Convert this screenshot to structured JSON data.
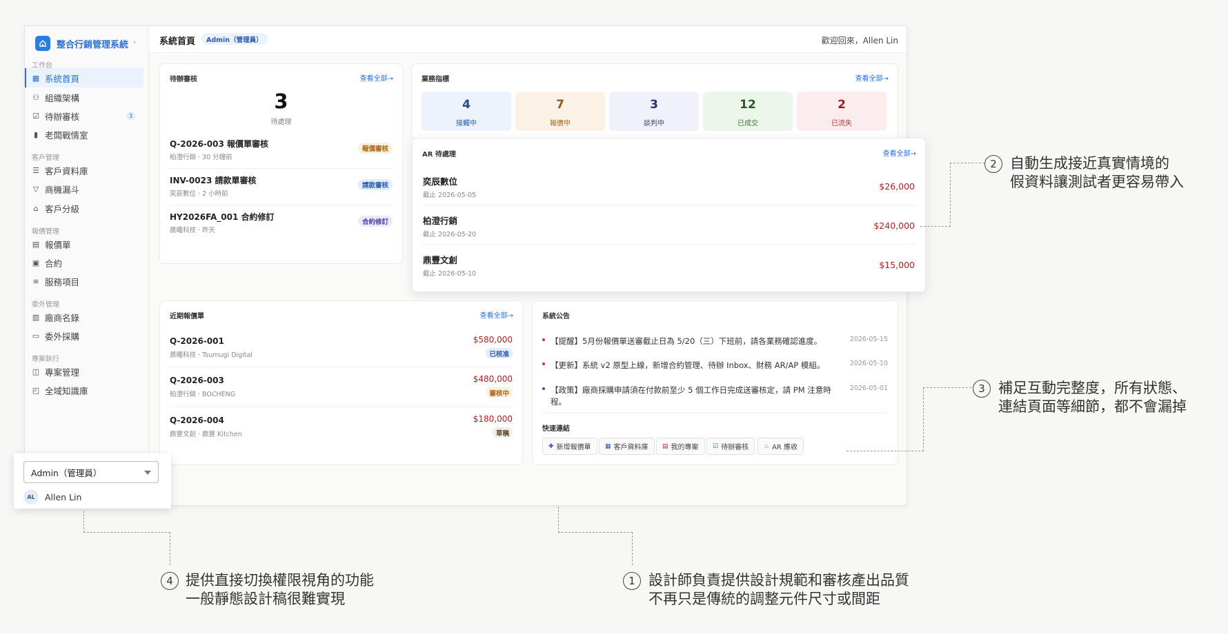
{
  "sidebar": {
    "brand": "整合行銷管理系統",
    "collapse_icon": "‹",
    "sections": [
      {
        "label": "工作台"
      },
      {
        "label": "客戶管理"
      },
      {
        "label": "報價管理"
      },
      {
        "label": "委外管理"
      },
      {
        "label": "專案執行"
      }
    ],
    "items": [
      {
        "label": "系統首頁",
        "icon": "grid-icon",
        "active": true
      },
      {
        "label": "組織架構",
        "icon": "org-chart-icon"
      },
      {
        "label": "待辦審核",
        "icon": "check-square-icon",
        "badge": "3"
      },
      {
        "label": "老闆戰情室",
        "icon": "bar-chart-icon"
      },
      {
        "label": "客戶資料庫",
        "icon": "database-icon"
      },
      {
        "label": "商機漏斗",
        "icon": "funnel-icon"
      },
      {
        "label": "客戶分級",
        "icon": "home-icon"
      },
      {
        "label": "報價單",
        "icon": "document-icon"
      },
      {
        "label": "合約",
        "icon": "contract-icon"
      },
      {
        "label": "服務項目",
        "icon": "list-icon"
      },
      {
        "label": "廠商名錄",
        "icon": "book-icon"
      },
      {
        "label": "委外採購",
        "icon": "purchase-icon"
      },
      {
        "label": "專案管理",
        "icon": "briefcase-icon"
      },
      {
        "label": "全域知識庫",
        "icon": "knowledge-icon"
      }
    ]
  },
  "role_switch": {
    "selected": "Admin（管理員）",
    "avatar": "AL",
    "user_name": "Allen Lin"
  },
  "header": {
    "title": "系統首頁",
    "role_badge": "Admin（管理員）",
    "welcome": "歡迎回來，Allen Lin"
  },
  "pending": {
    "title": "待辦審核",
    "link": "查看全部→",
    "count": "3",
    "count_label": "待處理",
    "items": [
      {
        "title": "Q-2026-003 報價單審核",
        "meta": "柏澄行銷 · 30 分鐘前",
        "tag": "報價審核"
      },
      {
        "title": "INV-0023 請款單審核",
        "meta": "奕辰數位 · 2 小時前",
        "tag": "請款審核"
      },
      {
        "title": "HY2026FA_001 合約修訂",
        "meta": "晨曦科技 · 昨天",
        "tag": "合約修訂"
      }
    ]
  },
  "kpi": {
    "title": "業務指標",
    "link": "查看全部→",
    "items": [
      {
        "value": "4",
        "label": "接觸中"
      },
      {
        "value": "7",
        "label": "報價中"
      },
      {
        "value": "3",
        "label": "談判中"
      },
      {
        "value": "12",
        "label": "已成交"
      },
      {
        "value": "2",
        "label": "已流失"
      }
    ]
  },
  "ar": {
    "title": "AR 待處理",
    "link": "查看全部→",
    "items": [
      {
        "name": "奕辰數位",
        "due": "截止 2026-05-05",
        "amount": "$26,000"
      },
      {
        "name": "柏澄行銷",
        "due": "截止 2026-05-20",
        "amount": "$240,000"
      },
      {
        "name": "鼎豐文創",
        "due": "截止 2026-05-10",
        "amount": "$15,000"
      }
    ]
  },
  "quotes": {
    "title": "近期報價單",
    "link": "查看全部→",
    "items": [
      {
        "id": "Q-2026-001",
        "meta": "晨曦科技 · Tsumugi Digital",
        "amount": "$580,000",
        "status": "已核准"
      },
      {
        "id": "Q-2026-003",
        "meta": "柏澄行銷 · BOCHENG",
        "amount": "$480,000",
        "status": "審核中"
      },
      {
        "id": "Q-2026-004",
        "meta": "鼎豐文創 · 鼎豐 Kitchen",
        "amount": "$180,000",
        "status": "草稿"
      }
    ]
  },
  "announcements": {
    "title": "系統公告",
    "items": [
      {
        "text": "【提醒】5月份報價單送審截止日為 5/20（三）下班前，請各業務確認進度。",
        "date": "2026-05-15"
      },
      {
        "text": "【更新】系統 v2 原型上線，新增合約管理、待辦 Inbox、財務 AR/AP 模組。",
        "date": "2026-05-10"
      },
      {
        "text": "【政策】廠商採購申請須在付款前至少 5 個工作日完成送審核定，請 PM 注意時程。",
        "date": "2026-05-01"
      }
    ],
    "quick_title": "快速連結",
    "quick_links": [
      {
        "icon": "✚",
        "label": "新增報價單"
      },
      {
        "icon": "▦",
        "label": "客戶資料庫"
      },
      {
        "icon": "▤",
        "label": "我的專案"
      },
      {
        "icon": "☑",
        "label": "待辦審核"
      },
      {
        "icon": "♨",
        "label": "AR 應收"
      }
    ]
  },
  "callouts": {
    "c1": {
      "num": "1",
      "line1": "設計師負責提供設計規範和審核產出品質",
      "line2": "不再只是傳統的調整元件尺寸或間距"
    },
    "c2": {
      "num": "2",
      "line1": "自動生成接近真實情境的",
      "line2": "假資料讓測試者更容易帶入"
    },
    "c3": {
      "num": "3",
      "line1": "補足互動完整度，所有狀態、",
      "line2": "連結頁面等細節，都不會漏掉"
    },
    "c4": {
      "num": "4",
      "line1": "提供直接切換權限視角的功能",
      "line2": "一般靜態設計稿很難實現"
    }
  }
}
